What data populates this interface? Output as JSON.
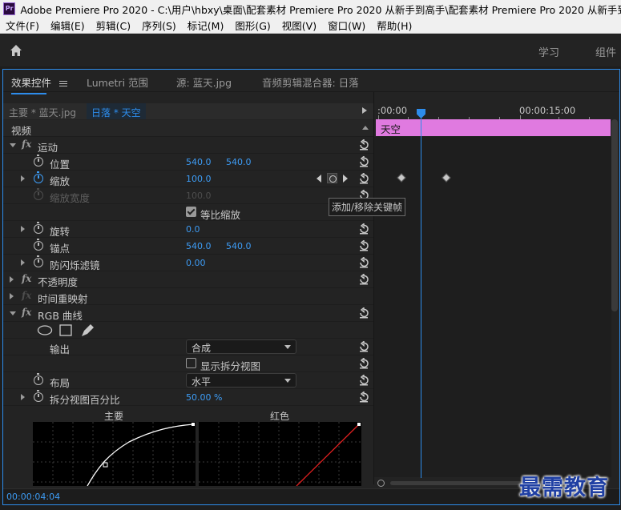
{
  "window": {
    "app_icon": "Pr",
    "title": "Adobe Premiere Pro 2020 - C:\\用户\\hbxy\\桌面\\配套素材 Premiere Pro 2020 从新手到高手\\配套素材 Premiere Pro 2020 从新手到高手\\"
  },
  "menu": [
    "文件(F)",
    "编辑(E)",
    "剪辑(C)",
    "序列(S)",
    "标记(M)",
    "图形(G)",
    "视图(V)",
    "窗口(W)",
    "帮助(H)"
  ],
  "workspace": {
    "home_icon": "home-icon",
    "tabs": [
      "学习",
      "组件"
    ]
  },
  "panel_tabs": [
    "效果控件",
    "Lumetri 范围",
    "源: 蓝天.jpg",
    "音频剪辑混合器: 日落"
  ],
  "clip_header": {
    "main": "主要 * 蓝天.jpg",
    "sequence": "日落 * 天空"
  },
  "rows": {
    "video": "视频",
    "motion": "运动",
    "position": {
      "label": "位置",
      "x": "540.0",
      "y": "540.0"
    },
    "scale": {
      "label": "缩放",
      "value": "100.0"
    },
    "scale_width": {
      "label": "缩放宽度",
      "value": "100.0"
    },
    "uniform_scale": {
      "label": "等比缩放",
      "checked": true
    },
    "rotation": {
      "label": "旋转",
      "value": "0.0"
    },
    "anchor": {
      "label": "锚点",
      "x": "540.0",
      "y": "540.0"
    },
    "antiflicker": {
      "label": "防闪烁滤镜",
      "value": "0.00"
    },
    "opacity": "不透明度",
    "time_remap": "时间重映射",
    "rgb_curves": "RGB 曲线",
    "output": {
      "label": "输出",
      "value": "合成"
    },
    "split_view": {
      "label": "显示拆分视图",
      "checked": false
    },
    "layout": {
      "label": "布局",
      "value": "水平"
    },
    "split_percent": {
      "label": "拆分视图百分比",
      "value": "50.00 %"
    }
  },
  "tooltip": "添加/移除关键帧",
  "curves": {
    "master": "主要",
    "red": "红色"
  },
  "timeline": {
    "start": ":00:00",
    "mid": "00:00:15:00",
    "clip": "天空"
  },
  "status": {
    "timecode": "00:00:04:04"
  },
  "watermark": "最需教育"
}
